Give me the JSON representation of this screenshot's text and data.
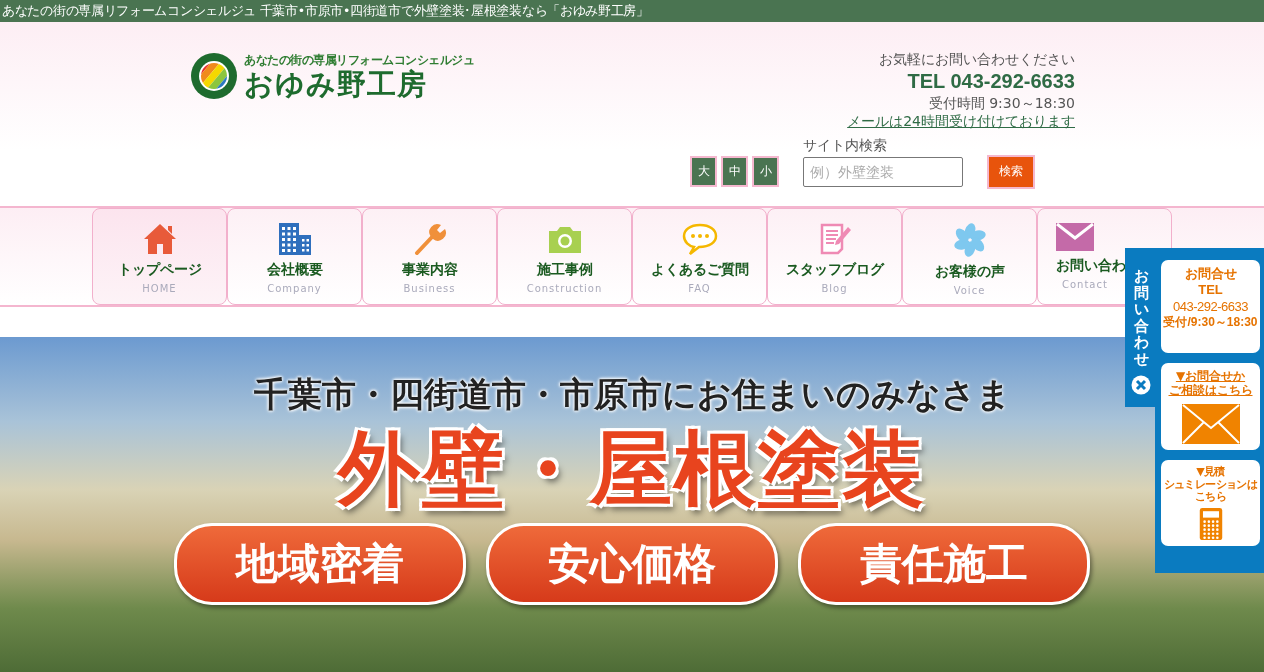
{
  "top_bar": {
    "text": "あなたの街の専属リフォームコンシェルジュ 千葉市•市原市•四街道市で外壁塗装･屋根塗装なら「おゆみ野工房」"
  },
  "header": {
    "logo": {
      "tagline": "あなたの街の専属リフォームコンシェルジュ",
      "name": "おゆみ野工房"
    },
    "contact": {
      "prompt": "お気軽にお問い合わせください",
      "tel": "TEL 043-292-6633",
      "hours": "受付時間 9:30～18:30",
      "mail_link": "メールは24時間受け付けております"
    },
    "font_size_buttons": [
      "大",
      "中",
      "小"
    ],
    "search": {
      "label": "サイト内検索",
      "placeholder": "例）外壁塗装",
      "button": "検索"
    }
  },
  "nav": [
    {
      "label": "トップページ",
      "sub": "HOME",
      "selected": true
    },
    {
      "label": "会社概要",
      "sub": "Company",
      "selected": false
    },
    {
      "label": "事業内容",
      "sub": "Business",
      "selected": false
    },
    {
      "label": "施工事例",
      "sub": "Construction",
      "selected": false
    },
    {
      "label": "よくあるご質問",
      "sub": "FAQ",
      "selected": false
    },
    {
      "label": "スタッフブログ",
      "sub": "Blog",
      "selected": false
    },
    {
      "label": "お客様の声",
      "sub": "Voice",
      "selected": false
    },
    {
      "label": "お問い合わ",
      "sub": "Contact",
      "selected": false
    }
  ],
  "hero": {
    "lead": "千葉市・四街道市・市原市にお住まいのみなさま",
    "headline": "外壁・屋根塗装",
    "badges": [
      "地域密着",
      "安心価格",
      "責任施工"
    ]
  },
  "side_panel": {
    "tab_label": "お問い合わせ",
    "cards": [
      {
        "kind": "tel",
        "lines": [
          "お問合せ",
          "TEL",
          "043-292-6633",
          "受付/9:30～18:30"
        ]
      },
      {
        "kind": "mail",
        "lines": [
          "▼お問合せか",
          "ご相談はこちら"
        ]
      },
      {
        "kind": "estimate",
        "lines": [
          "▼見積",
          "シュミレーションは",
          "こちら"
        ]
      }
    ]
  }
}
